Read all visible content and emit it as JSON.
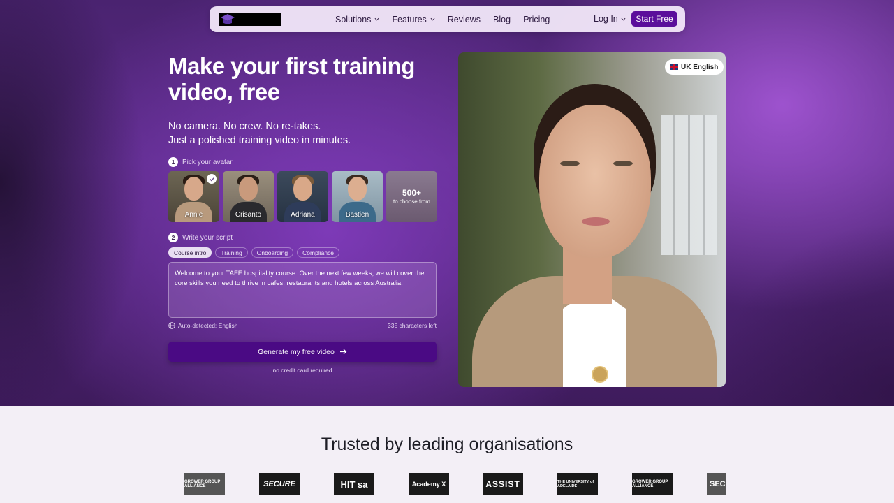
{
  "nav": {
    "links": [
      {
        "label": "Solutions",
        "dropdown": true
      },
      {
        "label": "Features",
        "dropdown": true
      },
      {
        "label": "Reviews",
        "dropdown": false
      },
      {
        "label": "Blog",
        "dropdown": false
      },
      {
        "label": "Pricing",
        "dropdown": false
      }
    ],
    "login": "Log In",
    "start": "Start Free"
  },
  "hero": {
    "headline": "Make your first training video, free",
    "sub_line1": "No camera. No crew. No re-takes.",
    "sub_line2": "Just a polished training video in minutes."
  },
  "step1": {
    "num": "1",
    "label": "Pick your avatar"
  },
  "avatars": [
    {
      "name": "Annie",
      "selected": true
    },
    {
      "name": "Crisanto",
      "selected": false
    },
    {
      "name": "Adriana",
      "selected": false
    },
    {
      "name": "Bastien",
      "selected": false
    }
  ],
  "more_avatars": {
    "count": "500+",
    "text": "to choose from"
  },
  "step2": {
    "num": "2",
    "label": "Write your script"
  },
  "script_tabs": [
    {
      "label": "Course intro",
      "active": true
    },
    {
      "label": "Training",
      "active": false
    },
    {
      "label": "Onboarding",
      "active": false
    },
    {
      "label": "Compliance",
      "active": false
    }
  ],
  "script_text": "Welcome to your TAFE hospitality course. Over the next few weeks, we will cover the core skills you need to thrive in cafes, restaurants and hotels across Australia.",
  "auto_detected": "Auto-detected: English",
  "chars_left": "335 characters left",
  "generate_label": "Generate my free video",
  "no_card": "no credit card required",
  "language_badge": "UK English",
  "trusted_title": "Trusted by leading organisations",
  "logos": [
    "GROWER GROUP ALLIANCE",
    "SECURE",
    "HIT sa",
    "Academy X",
    "ASSIST",
    "THE UNIVERSITY of ADELAIDE",
    "GROWER GROUP ALLIANCE",
    "SEC"
  ],
  "colors": {
    "accent": "#5b0e9b",
    "generate": "#4a0a84",
    "hero_purple": "#5a2b86"
  }
}
